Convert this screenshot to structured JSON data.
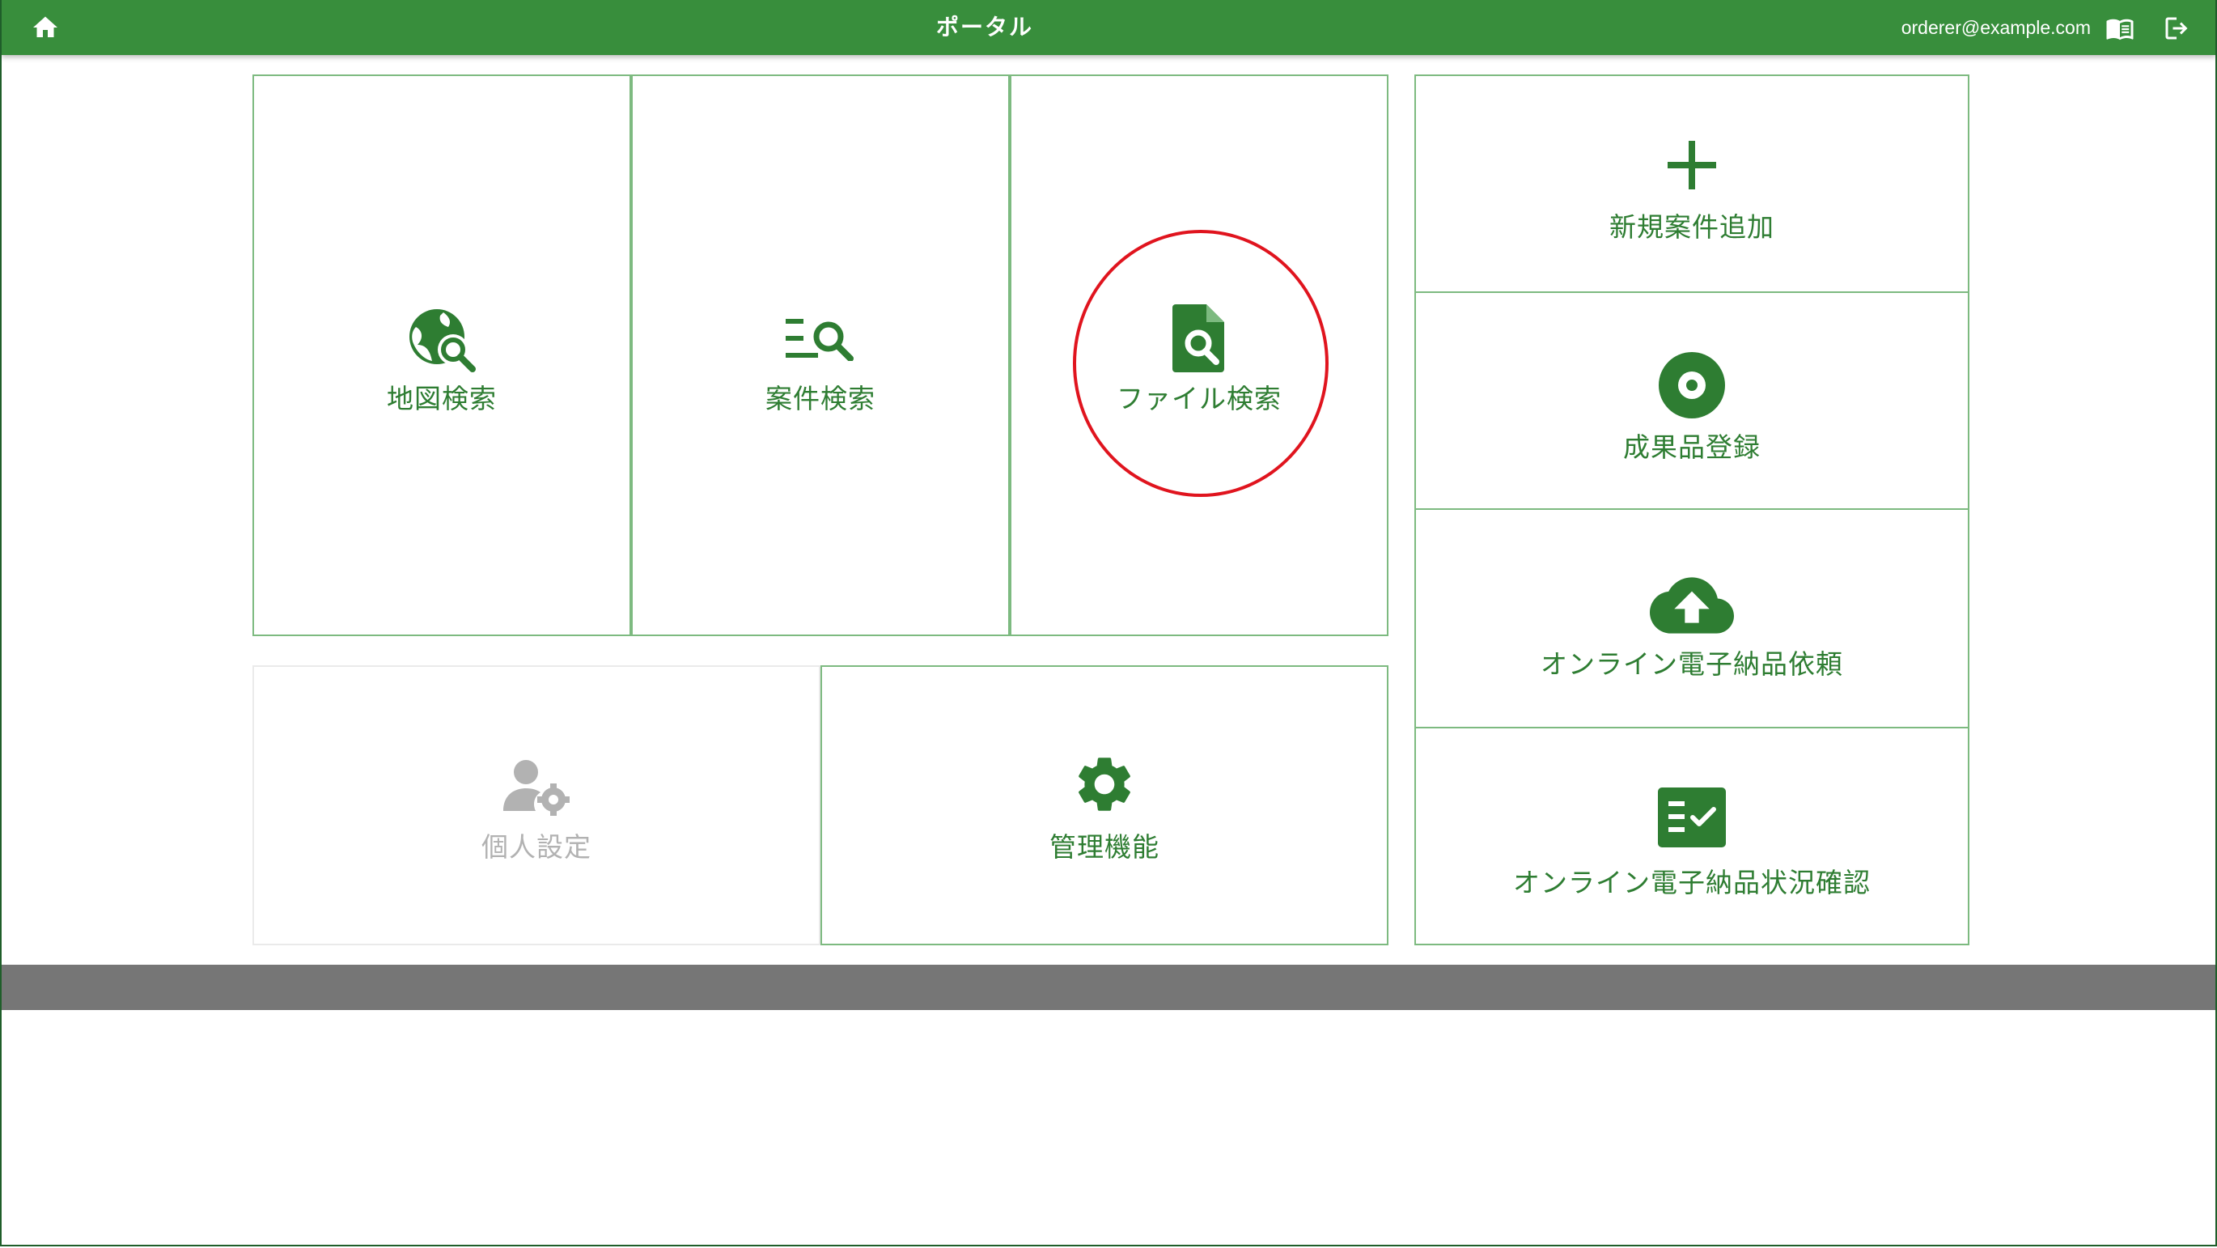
{
  "header": {
    "title": "ポータル",
    "user_email": "orderer@example.com",
    "icons": {
      "home": "home-icon",
      "manual": "manual-book-icon",
      "logout": "logout-icon"
    }
  },
  "tiles": {
    "map_search": {
      "label": "地図検索",
      "icon": "map-search-icon"
    },
    "case_search": {
      "label": "案件検索",
      "icon": "list-search-icon"
    },
    "file_search": {
      "label": "ファイル検索",
      "icon": "file-search-icon"
    },
    "personal_settings": {
      "label": "個人設定",
      "icon": "user-settings-icon",
      "enabled": false
    },
    "admin_functions": {
      "label": "管理機能",
      "icon": "gear-icon"
    },
    "new_case": {
      "label": "新規案件追加",
      "icon": "plus-icon"
    },
    "deliverable_registration": {
      "label": "成果品登録",
      "icon": "disc-icon"
    },
    "online_delivery_request": {
      "label": "オンライン電子納品依頼",
      "icon": "cloud-upload-icon"
    },
    "online_delivery_status": {
      "label": "オンライン電子納品状況確認",
      "icon": "checklist-icon"
    }
  },
  "colors": {
    "primary": "#388e3c",
    "accent_text": "#2e7d32",
    "tile_border": "#7dba80",
    "disabled": "#b2b2b2",
    "footer_bar": "#767676",
    "annotation": "#e0141e"
  }
}
